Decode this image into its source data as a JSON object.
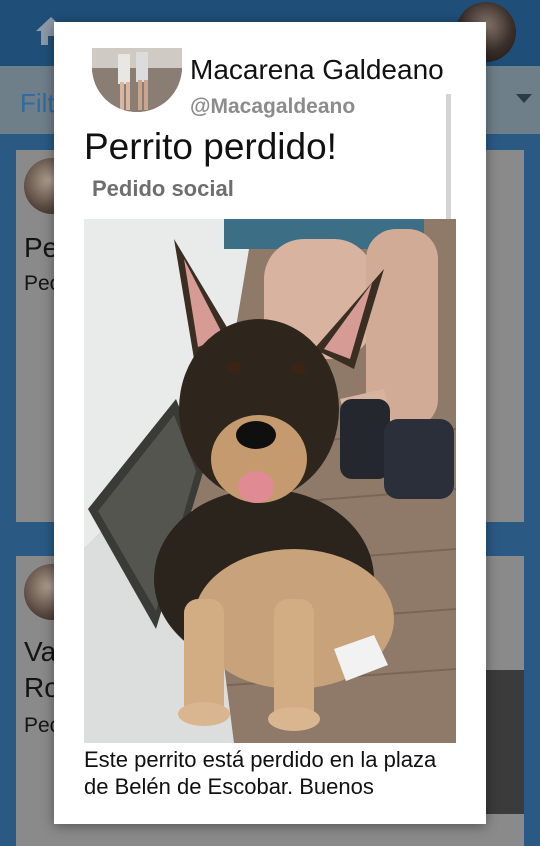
{
  "background": {
    "filter_label": "Filt",
    "cards": [
      {
        "title": "Pe",
        "subtitle": "Pec"
      },
      {
        "title_line1": "Va",
        "title_line2": "Ro",
        "subtitle": "Pec"
      }
    ]
  },
  "modal": {
    "user_name": "Macarena Galdeano",
    "user_handle": "@Macagaldeano",
    "post_title": "Perrito perdido!",
    "post_category": "Pedido social",
    "post_body": "Este perrito está perdido en la plaza de Belén de Escobar, Buenos"
  },
  "icons": {
    "home": "home-icon",
    "dropdown": "chevron-down-icon"
  },
  "colors": {
    "topbar": "#1f4f78",
    "accent": "#2f6aa0",
    "feed_background": "#2a5a84",
    "modal_background": "#ffffff",
    "handle_text": "#8c8c8c",
    "category_text": "#6e6e6e"
  }
}
